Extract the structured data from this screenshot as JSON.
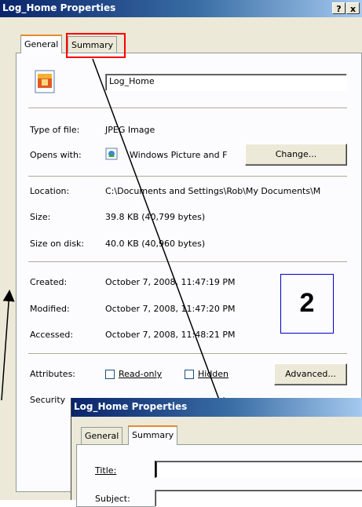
{
  "main_window": {
    "title": "Log_Home Properties",
    "help_btn": "?",
    "close_btn": "x",
    "tabs": [
      "General",
      "Summary"
    ],
    "file_name": "Log_Home",
    "type_label": "Type of file:",
    "type_value": "JPEG Image",
    "opens_label": "Opens with:",
    "opens_value": "Windows Picture and F",
    "change_btn": "Change...",
    "location_label": "Location:",
    "location_value": "C:\\Documents and Settings\\Rob\\My Documents\\M",
    "size_label": "Size:",
    "size_value": "39.8 KB (40,799 bytes)",
    "size_disk_label": "Size on disk:",
    "size_disk_value": "40.0 KB (40,960 bytes)",
    "created_label": "Created:",
    "created_value": "October 7, 2008, 11:47:19 PM",
    "modified_label": "Modified:",
    "modified_value": "October 7, 2008, 11:47:20 PM",
    "accessed_label": "Accessed:",
    "accessed_value": "October 7, 2008, 11:48:21 PM",
    "attributes_label": "Attributes:",
    "readonly_label": "Read-only",
    "hidden_label": "Hidden",
    "advanced_btn": "Advanced...",
    "security_label": "Security"
  },
  "annotation": {
    "step_number": "2",
    "highlight_color": "#ff0000",
    "box_color": "#0000cc"
  },
  "second_window": {
    "title": "Log_Home Properties",
    "tabs": [
      "General",
      "Summary"
    ],
    "title_label": "Title:",
    "subject_label": "Subject:",
    "title_value": ""
  }
}
